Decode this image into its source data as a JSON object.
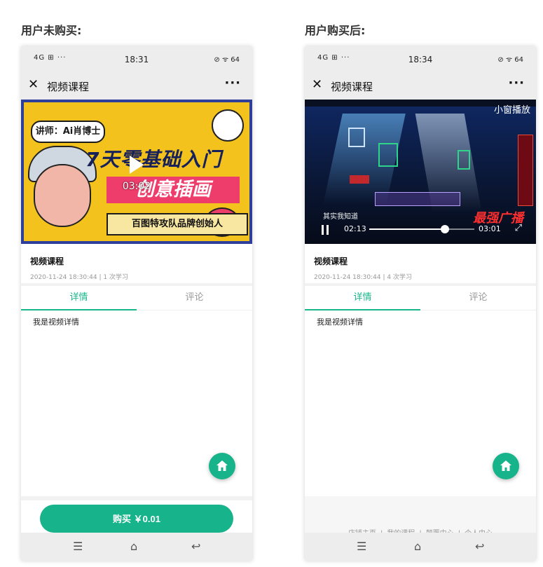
{
  "left_title": "用户未购买:",
  "right_title": "用户购买后:",
  "phones": {
    "left": {
      "status_left": "4G ⊞ ···",
      "time": "18:31",
      "status_right": "⊘ ᯤ 64",
      "nav_title": "视频课程",
      "cover_teacher": "讲师：Ai肖博士",
      "cover_headline1": "7天零基础入门",
      "cover_headline2": "创意插画",
      "cover_subline": "百图特攻队品牌创始人",
      "duration": "03:02",
      "course_title": "视频课程",
      "meta": "2020-11-24 18:30:44 | 1 次学习",
      "tab_details": "详情",
      "tab_comments": "评论",
      "detail_text": "我是视频详情",
      "buy_button": "购买 ￥0.01"
    },
    "right": {
      "status_left": "4G ⊞ ···",
      "time": "18:34",
      "status_right": "⊘ ᯤ 64",
      "nav_title": "视频课程",
      "small_window": "小窗播放",
      "subtitle": "其实我知道",
      "current_time": "02:13",
      "total_time": "03:01",
      "progress": 0.72,
      "big_red": "最强广播",
      "course_title": "视频课程",
      "meta": "2020-11-24 18:30:44 | 4 次学习",
      "tab_details": "详情",
      "tab_comments": "评论",
      "detail_text": "我是视频详情",
      "footer": {
        "link1": "店铺主页",
        "link2": "我的课程",
        "link3": "颠覆中心",
        "link4": "个人中心"
      }
    }
  },
  "colors": {
    "accent": "#17b38a",
    "tab_active": "#19b68b"
  },
  "icons": {
    "close": "✕",
    "more": "···",
    "home": "home-icon",
    "sys_menu": "☰",
    "sys_home": "⌂",
    "sys_back": "↩",
    "fullscreen": "⤢"
  }
}
